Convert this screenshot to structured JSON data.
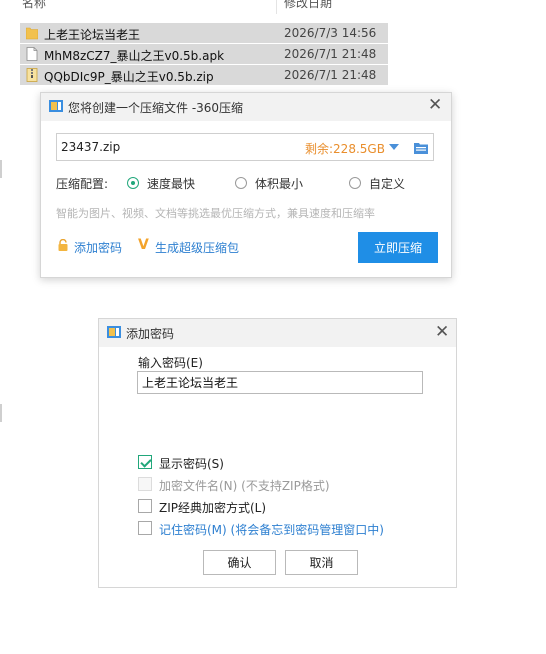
{
  "explorer": {
    "columns": {
      "name": "名称",
      "date": "修改日期"
    },
    "files": [
      {
        "name": "上老王论坛当老王",
        "date": "2026/7/3 14:56",
        "icon": "folder-icon"
      },
      {
        "name": "MhM8zCZ7_暴山之王v0.5b.apk",
        "date": "2026/7/1 21:48",
        "icon": "file-icon"
      },
      {
        "name": "QQbDIc9P_暴山之王v0.5b.zip",
        "date": "2026/7/1 21:48",
        "icon": "zip-icon"
      }
    ]
  },
  "compress_dialog": {
    "title": "您将创建一个压缩文件 -360压缩",
    "filename": "23437.zip",
    "free_space": "剩余:228.5GB",
    "config_label": "压缩配置:",
    "options": [
      "速度最快",
      "体积最小",
      "自定义"
    ],
    "selected_option": "速度最快",
    "hint": "智能为图片、视频、文档等挑选最优压缩方式，兼具速度和压缩率",
    "add_password": "添加密码",
    "super_pack": "生成超级压缩包",
    "compress_now": "立即压缩"
  },
  "password_dialog": {
    "title": "添加密码",
    "input_label": "输入密码(E)",
    "password_value": "上老王论坛当老王",
    "checkboxes": [
      {
        "label": "显示密码(S)",
        "checked": true,
        "enabled": true
      },
      {
        "label": "加密文件名(N) (不支持ZIP格式)",
        "checked": false,
        "enabled": false
      },
      {
        "label": "ZIP经典加密方式(L)",
        "checked": false,
        "enabled": true
      },
      {
        "label": "记住密码(M) (将会备忘到密码管理窗口中)",
        "checked": false,
        "enabled": true
      }
    ],
    "ok": "确认",
    "cancel": "取消"
  },
  "colors": {
    "accent_green": "#21a77b",
    "accent_blue": "#1f8ee6",
    "link_blue": "#2d7fd0",
    "free_space_orange": "#e98e2c"
  }
}
